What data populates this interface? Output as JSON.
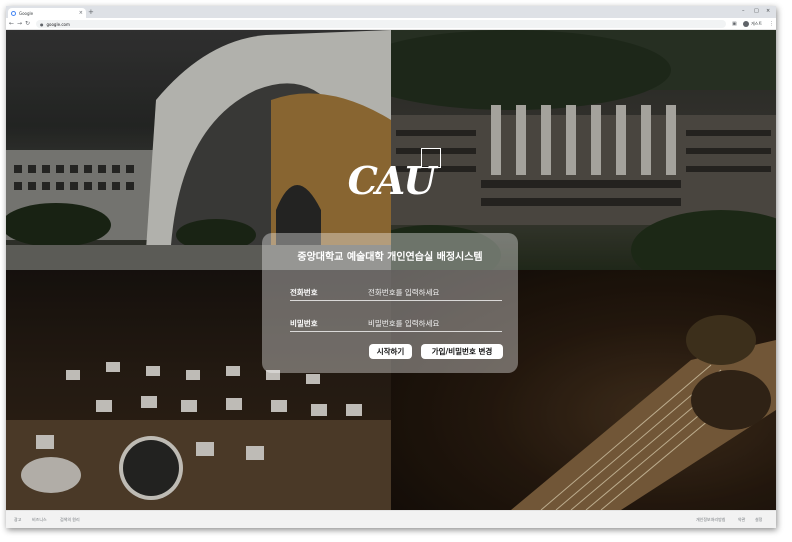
{
  "browser": {
    "tab_title": "Google",
    "tab_close": "×",
    "new_tab": "+",
    "minimize": "–",
    "maximize": "□",
    "close": "×",
    "back": "←",
    "forward": "→",
    "reload": "↻",
    "lock": "●",
    "url": "google.com",
    "profile_name": "게스트",
    "menu": "⋮",
    "extensions": "▣"
  },
  "logo": {
    "text": "CAU"
  },
  "login": {
    "title": "중앙대학교 예술대학 개인연습실 배정시스템",
    "phone_label": "전화번호",
    "phone_placeholder": "전화번호를 입력하세요",
    "password_label": "비밀번호",
    "password_placeholder": "비밀번호를 입력하세요",
    "start_button": "시작하기",
    "register_button": "가입/비밀번호 변경"
  },
  "footer": {
    "left": [
      "광고",
      "비즈니스",
      "검색의 원리"
    ],
    "right": [
      "개인정보처리방침",
      "약관",
      "설정"
    ]
  }
}
